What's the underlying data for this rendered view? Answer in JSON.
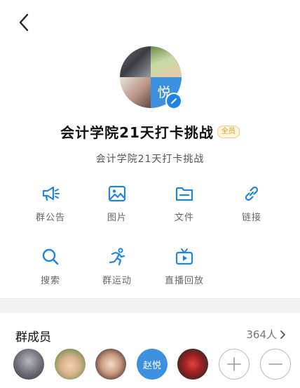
{
  "group": {
    "avatar_text": "悦",
    "title": "会计学院21天打卡挑战",
    "badge": "全员",
    "subtitle": "会计学院21天打卡挑战"
  },
  "functions": [
    {
      "label": "群公告",
      "icon": "megaphone-icon"
    },
    {
      "label": "图片",
      "icon": "image-icon"
    },
    {
      "label": "文件",
      "icon": "folder-icon"
    },
    {
      "label": "链接",
      "icon": "link-icon"
    },
    {
      "label": "搜索",
      "icon": "search-icon"
    },
    {
      "label": "群运动",
      "icon": "running-icon"
    },
    {
      "label": "直播回放",
      "icon": "tv-icon"
    }
  ],
  "members": {
    "header": "群成员",
    "count": "364人",
    "list": [
      {
        "type": "photo"
      },
      {
        "type": "photo"
      },
      {
        "type": "photo"
      },
      {
        "type": "text",
        "text": "赵悦"
      },
      {
        "type": "photo"
      }
    ]
  },
  "colors": {
    "accent": "#1f84e8",
    "badge": "#d89a2a"
  }
}
